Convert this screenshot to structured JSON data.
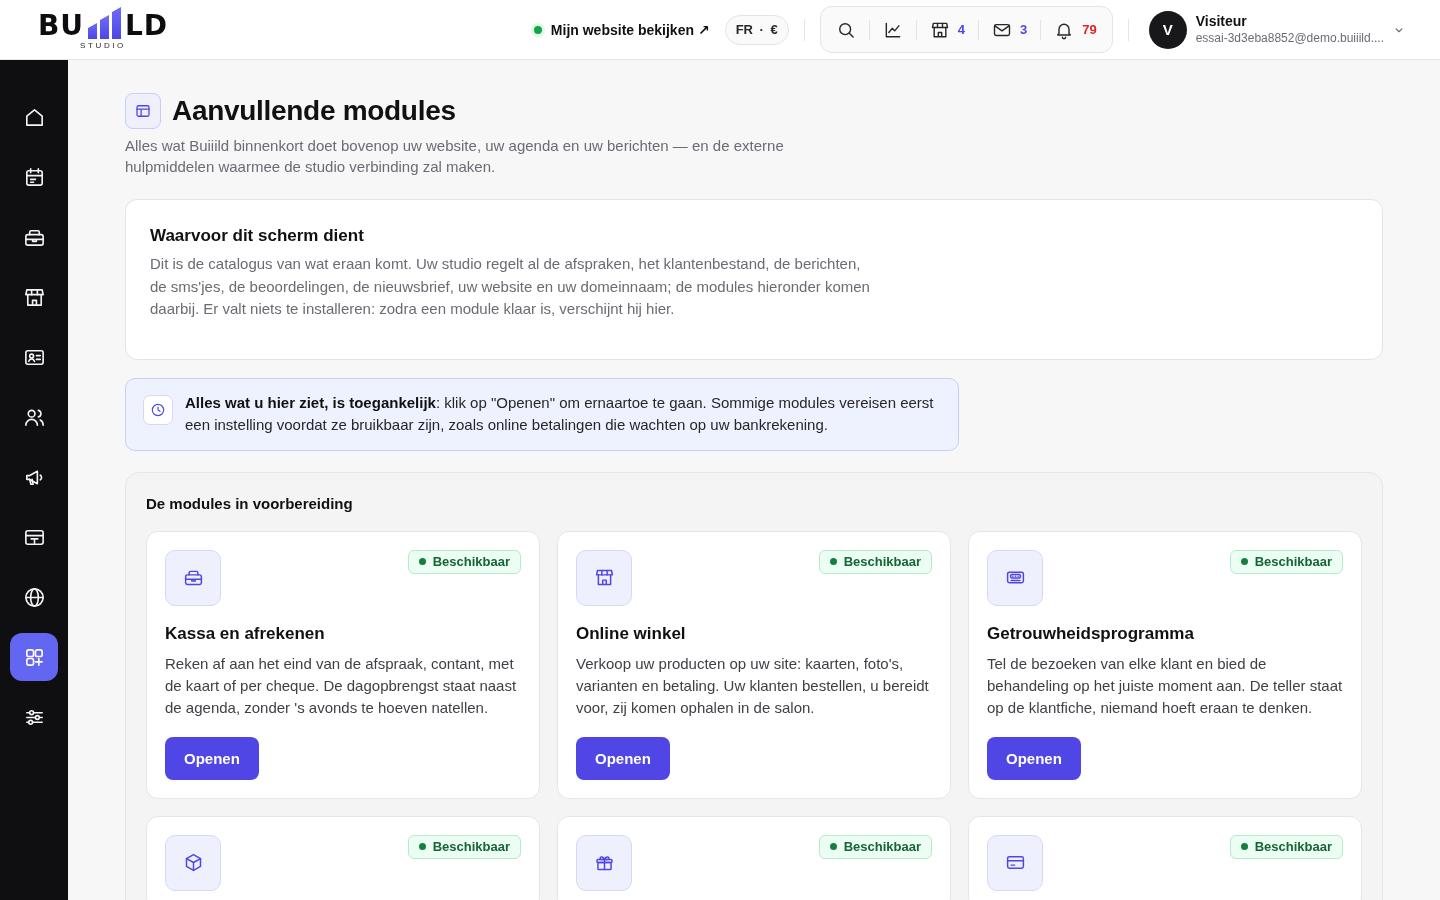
{
  "header": {
    "logo": {
      "left": "BU",
      "right": "LD",
      "tagline": "STUDIO"
    },
    "site_link": {
      "label": "Mijn website bekijken ↗",
      "live": true
    },
    "locale": "FR · €",
    "toolbar": [
      {
        "kind": "search"
      },
      {
        "kind": "chart"
      },
      {
        "kind": "store",
        "count": "4",
        "color": "#4f46e5"
      },
      {
        "kind": "mail",
        "count": "3",
        "color": "#4f46e5"
      },
      {
        "kind": "bell",
        "count": "79",
        "color": "#dc2626"
      }
    ],
    "user": {
      "initial": "V",
      "name": "Visiteur",
      "email": "essai-3d3eba8852@demo.buiiild...."
    }
  },
  "sidebar": {
    "items": [
      {
        "kind": "home",
        "selected": false
      },
      {
        "kind": "calendar",
        "selected": false
      },
      {
        "kind": "briefcase",
        "selected": false
      },
      {
        "kind": "store",
        "selected": false
      },
      {
        "kind": "id-card",
        "selected": false
      },
      {
        "kind": "users",
        "selected": false
      },
      {
        "kind": "megaphone",
        "selected": false
      },
      {
        "kind": "register-card",
        "selected": false
      },
      {
        "kind": "globe",
        "selected": false
      },
      {
        "kind": "grid-plus",
        "selected": true
      },
      {
        "kind": "sliders",
        "selected": false
      }
    ]
  },
  "page": {
    "title": "Aanvullende modules",
    "subtitle": "Alles wat Buiiild binnenkort doet bovenop uw website, uw agenda en uw berichten — en de externe hulpmiddelen waarmee de studio verbinding zal maken."
  },
  "intro_card": {
    "title": "Waarvoor dit scherm dient",
    "body": "Dit is de catalogus van wat eraan komt. Uw studio regelt al de afspraken, het klantenbestand, de berichten, de sms'jes, de beoordelingen, de nieuwsbrief, uw website en uw domeinnaam; de modules hieronder komen daarbij. Er valt niets te installeren: zodra een module klaar is, verschijnt hij hier."
  },
  "notice": {
    "text": "**Alles wat u hier ziet, is toegankelijk**: klik op \"Openen\" om ernaartoe te gaan. Sommige modules vereisen eerst een instelling voordat ze bruikbaar zijn, zoals online betalingen die wachten op uw bankrekening."
  },
  "modules": {
    "title": "De modules in voorbereiding",
    "items": [
      {
        "kind": "briefcase",
        "badge": "Beschikbaar",
        "title": "Kassa en afrekenen",
        "description": "Reken af aan het eind van de afspraak, contant, met de kaart of per cheque. De dagopbrengst staat naast de agenda, zonder 's avonds te hoeven natellen.",
        "button": "Openen"
      },
      {
        "kind": "store",
        "badge": "Beschikbaar",
        "title": "Online winkel",
        "description": "Verkoop uw producten op uw site: kaarten, foto's, varianten en betaling. Uw klanten bestellen, u bereidt voor, zij komen ophalen in de salon.",
        "button": "Openen"
      },
      {
        "kind": "ticket",
        "badge": "Beschikbaar",
        "title": "Getrouwheidsprogramma",
        "description": "Tel de bezoeken van elke klant en bied de behandeling op het juiste moment aan. De teller staat op de klantfiche, niemand hoeft eraan te denken.",
        "button": "Openen"
      },
      {
        "kind": "cube",
        "badge": "Beschikbaar"
      },
      {
        "kind": "gift",
        "badge": "Beschikbaar"
      },
      {
        "kind": "credit-card",
        "badge": "Beschikbaar"
      }
    ]
  }
}
